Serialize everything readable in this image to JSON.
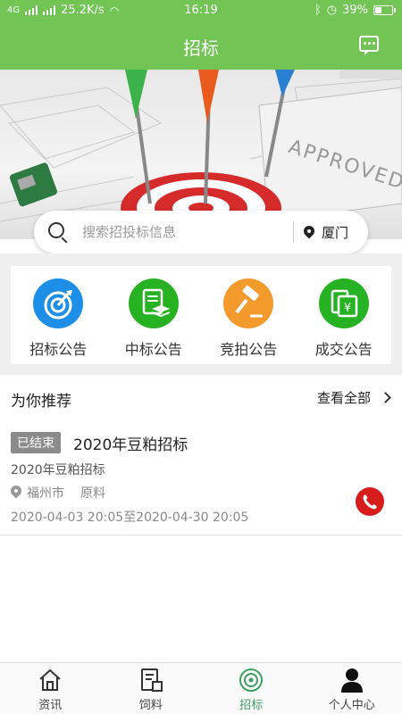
{
  "status_bar": {
    "network": "4G",
    "speed": "25.2K/s",
    "time": "16:19",
    "battery": "39%",
    "battery_level": 0.39
  },
  "header": {
    "title": "招标",
    "message_icon": "chat-bubble-icon"
  },
  "search": {
    "placeholder": "搜索招投标信息",
    "city": "厦门"
  },
  "categories": [
    {
      "label": "招标公告",
      "icon": "target-icon",
      "color": "#1e8fe8"
    },
    {
      "label": "中标公告",
      "icon": "document-stack-icon",
      "color": "#27b224"
    },
    {
      "label": "竞拍公告",
      "icon": "gavel-icon",
      "color": "#f39a2c"
    },
    {
      "label": "成交公告",
      "icon": "yuan-document-icon",
      "color": "#27b224"
    }
  ],
  "recommend": {
    "title": "为你推荐",
    "view_all": "查看全部",
    "items": [
      {
        "status": "已结束",
        "name": "2020年豆粕招标",
        "subtitle": "2020年豆粕招标",
        "city": "福州市",
        "category": "原料",
        "date_range": "2020-04-03 20:05至2020-04-30 20:05"
      }
    ]
  },
  "bottom_nav": [
    {
      "label": "资讯",
      "icon": "home-icon"
    },
    {
      "label": "饲料",
      "icon": "feed-doc-icon"
    },
    {
      "label": "招标",
      "icon": "target-icon",
      "active": true
    },
    {
      "label": "个人中心",
      "icon": "person-icon"
    }
  ],
  "colors": {
    "brand_green": "#72c455",
    "active_tab": "#3ea060",
    "phone_red": "#d71c1c"
  }
}
